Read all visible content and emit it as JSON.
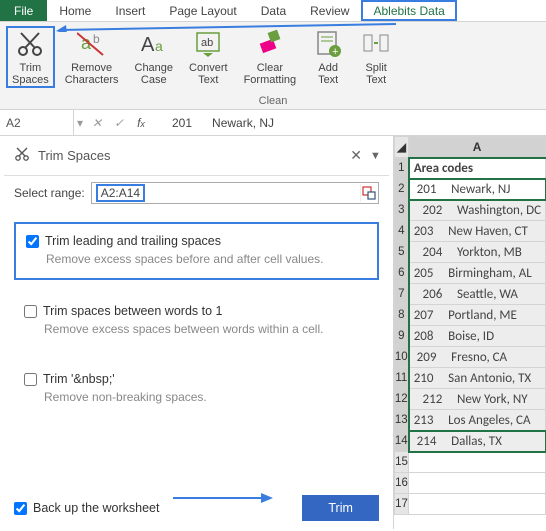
{
  "menu": {
    "file": "File",
    "tabs": [
      "Home",
      "Insert",
      "Page Layout",
      "Data",
      "Review",
      "Ablebits Data"
    ],
    "active": "Ablebits Data"
  },
  "ribbon": {
    "group_label": "Clean",
    "buttons": [
      {
        "label1": "Trim",
        "label2": "Spaces",
        "name": "trim-spaces-button",
        "active": true,
        "icon": "scissors"
      },
      {
        "label1": "Remove",
        "label2": "Characters",
        "name": "remove-characters-button",
        "active": false,
        "icon": "remove-chars"
      },
      {
        "label1": "Change",
        "label2": "Case",
        "name": "change-case-button",
        "active": false,
        "icon": "change-case"
      },
      {
        "label1": "Convert",
        "label2": "Text",
        "name": "convert-text-button",
        "active": false,
        "icon": "convert-text"
      },
      {
        "label1": "Clear",
        "label2": "Formatting",
        "name": "clear-formatting-button",
        "active": false,
        "icon": "clear-format"
      },
      {
        "label1": "Add",
        "label2": "Text",
        "name": "add-text-button",
        "active": false,
        "icon": "add-text"
      },
      {
        "label1": "Split",
        "label2": "Text",
        "name": "split-text-button",
        "active": false,
        "icon": "split-text"
      }
    ]
  },
  "formula_bar": {
    "name_box": "A2",
    "value": "   201      Newark, NJ"
  },
  "panel": {
    "title": "Trim Spaces",
    "select_range_label": "Select range:",
    "range_value": "A2:A14",
    "opt1": {
      "checked": true,
      "label": "Trim leading and trailing spaces",
      "desc": "Remove excess spaces before and after cell values."
    },
    "opt2": {
      "checked": false,
      "label": "Trim spaces between words to 1",
      "desc": "Remove excess spaces between words within a cell."
    },
    "opt3": {
      "checked": false,
      "label": "Trim  '&nbsp;'",
      "desc": "Remove non-breaking spaces."
    },
    "backup": {
      "checked": true,
      "label": "Back up the worksheet"
    },
    "trim_button": "Trim"
  },
  "grid": {
    "col_header": "A",
    "header_cell": "Area codes",
    "rows": [
      " 201     Newark, NJ",
      "   202     Washington, DC",
      "203     New Haven, CT",
      "   204     Yorkton, MB",
      "205     Birmingham, AL",
      "   206     Seattle, WA",
      "207     Portland, ME",
      "208     Boise, ID",
      " 209     Fresno, CA",
      "210     San Antonio, TX",
      "   212     New York, NY",
      "213     Los Angeles, CA",
      " 214     Dallas, TX"
    ],
    "empty_rows": [
      15,
      16,
      17
    ]
  }
}
